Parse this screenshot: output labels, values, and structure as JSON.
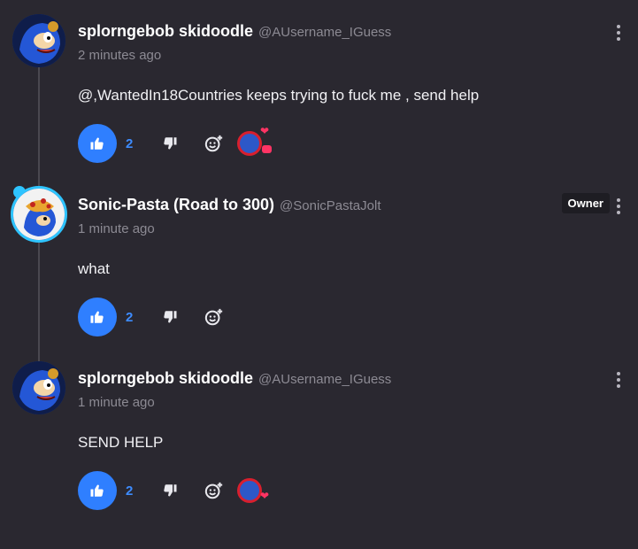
{
  "comments": [
    {
      "display_name": "splorngebob skidoodle",
      "handle": "@AUsername_IGuess",
      "timestamp": "2 minutes ago",
      "body": "@,WantedIn18Countries keeps trying to fuck me , send help",
      "likes": "2",
      "owner_tag": "",
      "reactions": [
        "heart",
        "comment"
      ]
    },
    {
      "display_name": "Sonic-Pasta (Road to 300)",
      "handle": "@SonicPastaJolt",
      "timestamp": "1 minute ago",
      "body": "what",
      "likes": "2",
      "owner_tag": "Owner",
      "reactions": []
    },
    {
      "display_name": "splorngebob skidoodle",
      "handle": "@AUsername_IGuess",
      "timestamp": "1 minute ago",
      "body": "SEND HELP",
      "likes": "2",
      "owner_tag": "",
      "reactions": [
        "heart"
      ]
    }
  ],
  "icons": {
    "like": "thumbs-up-icon",
    "dislike": "thumbs-down-icon",
    "react": "add-reaction-icon",
    "menu": "more-vertical-icon"
  },
  "colors": {
    "background": "#2a2830",
    "accent": "#2f7fff",
    "owner_ring": "#2ec4ff",
    "heart": "#ff3464"
  }
}
